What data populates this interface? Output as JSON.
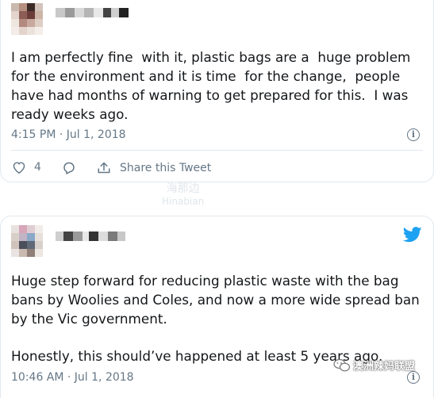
{
  "tweet1": {
    "text": "I am perfectly fine  with it, plastic bags are a  huge problem for the environment and it is time  for the change,  people have had months of warning to get prepared for this.  I was ready weeks ago.",
    "timestamp": "4:15 PM · Jul 1, 2018",
    "like_count": "4",
    "share_label": "Share this Tweet"
  },
  "tweet2": {
    "paragraph1": "Huge step forward for reducing plastic waste with the bag bans by Woolies and Coles, and now a more wide spread ban by the Vic government.",
    "paragraph2": "Honestly, this should’ve happened at least 5 years ago.",
    "timestamp": "10:46 AM · Jul 1, 2018"
  },
  "watermarks": {
    "center_line1": "海那边",
    "center_line2": "Hinabian",
    "corner": "澳洲辣妈联盟"
  },
  "colors": {
    "text": "#14171a",
    "secondary": "#657786",
    "border": "#e1e8ed",
    "twitter_blue": "#1da1f2"
  },
  "icons": [
    "heart-icon",
    "reply-icon",
    "share-icon",
    "info-icon",
    "twitter-bird-icon",
    "wechat-icon"
  ]
}
